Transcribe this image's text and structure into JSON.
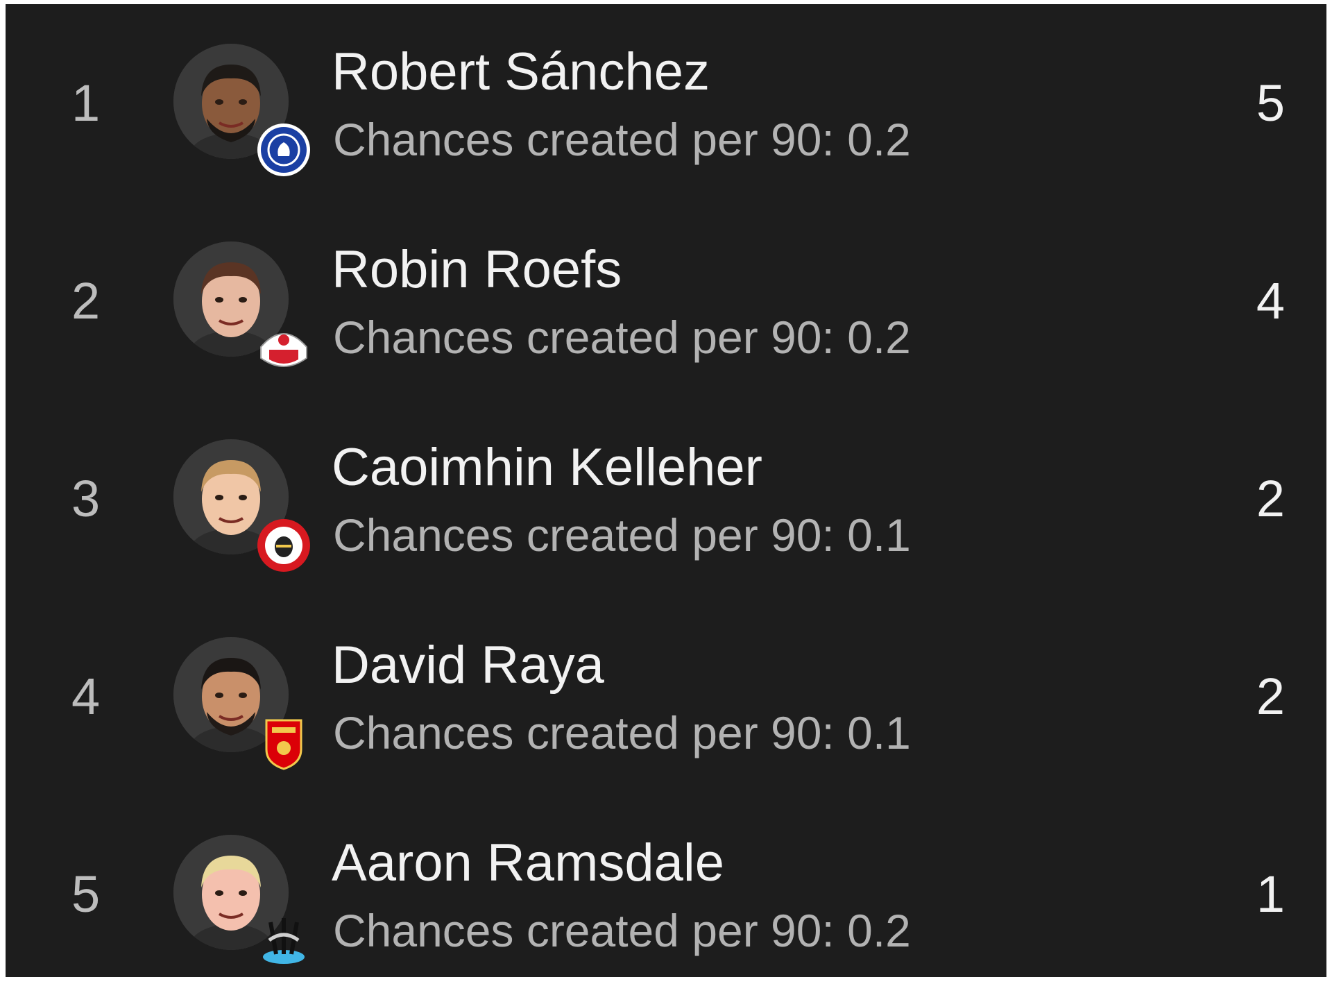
{
  "players": [
    {
      "rank": "1",
      "name": "Robert Sánchez",
      "stat": "Chances created per 90: 0.2",
      "value": "5",
      "skin": "#8a5a3c",
      "hair": "#1e1a17",
      "beard": "#1b1714",
      "club": "chelsea-badge-icon",
      "club_primary": "#1a3fa3",
      "club_secondary": "#ffffff"
    },
    {
      "rank": "2",
      "name": "Robin Roefs",
      "stat": "Chances created per 90: 0.2",
      "value": "4",
      "skin": "#e6b8a0",
      "hair": "#5a3424",
      "beard": "",
      "club": "sunderland-badge-icon",
      "club_primary": "#d5202e",
      "club_secondary": "#ffffff"
    },
    {
      "rank": "3",
      "name": "Caoimhin Kelleher",
      "stat": "Chances created per 90: 0.1",
      "value": "2",
      "skin": "#f0c6a6",
      "hair": "#c79a63",
      "beard": "",
      "club": "brentford-badge-icon",
      "club_primary": "#d71920",
      "club_secondary": "#ffffff"
    },
    {
      "rank": "4",
      "name": "David Raya",
      "stat": "Chances created per 90: 0.1",
      "value": "2",
      "skin": "#c9906a",
      "hair": "#1a1614",
      "beard": "#201a17",
      "club": "arsenal-badge-icon",
      "club_primary": "#db0007",
      "club_secondary": "#f2c94c"
    },
    {
      "rank": "5",
      "name": "Aaron Ramsdale",
      "stat": "Chances created per 90: 0.2",
      "value": "1",
      "skin": "#f4c0ae",
      "hair": "#e8d89a",
      "beard": "",
      "club": "newcastle-badge-icon",
      "club_primary": "#111111",
      "club_secondary": "#41b6e6"
    }
  ]
}
